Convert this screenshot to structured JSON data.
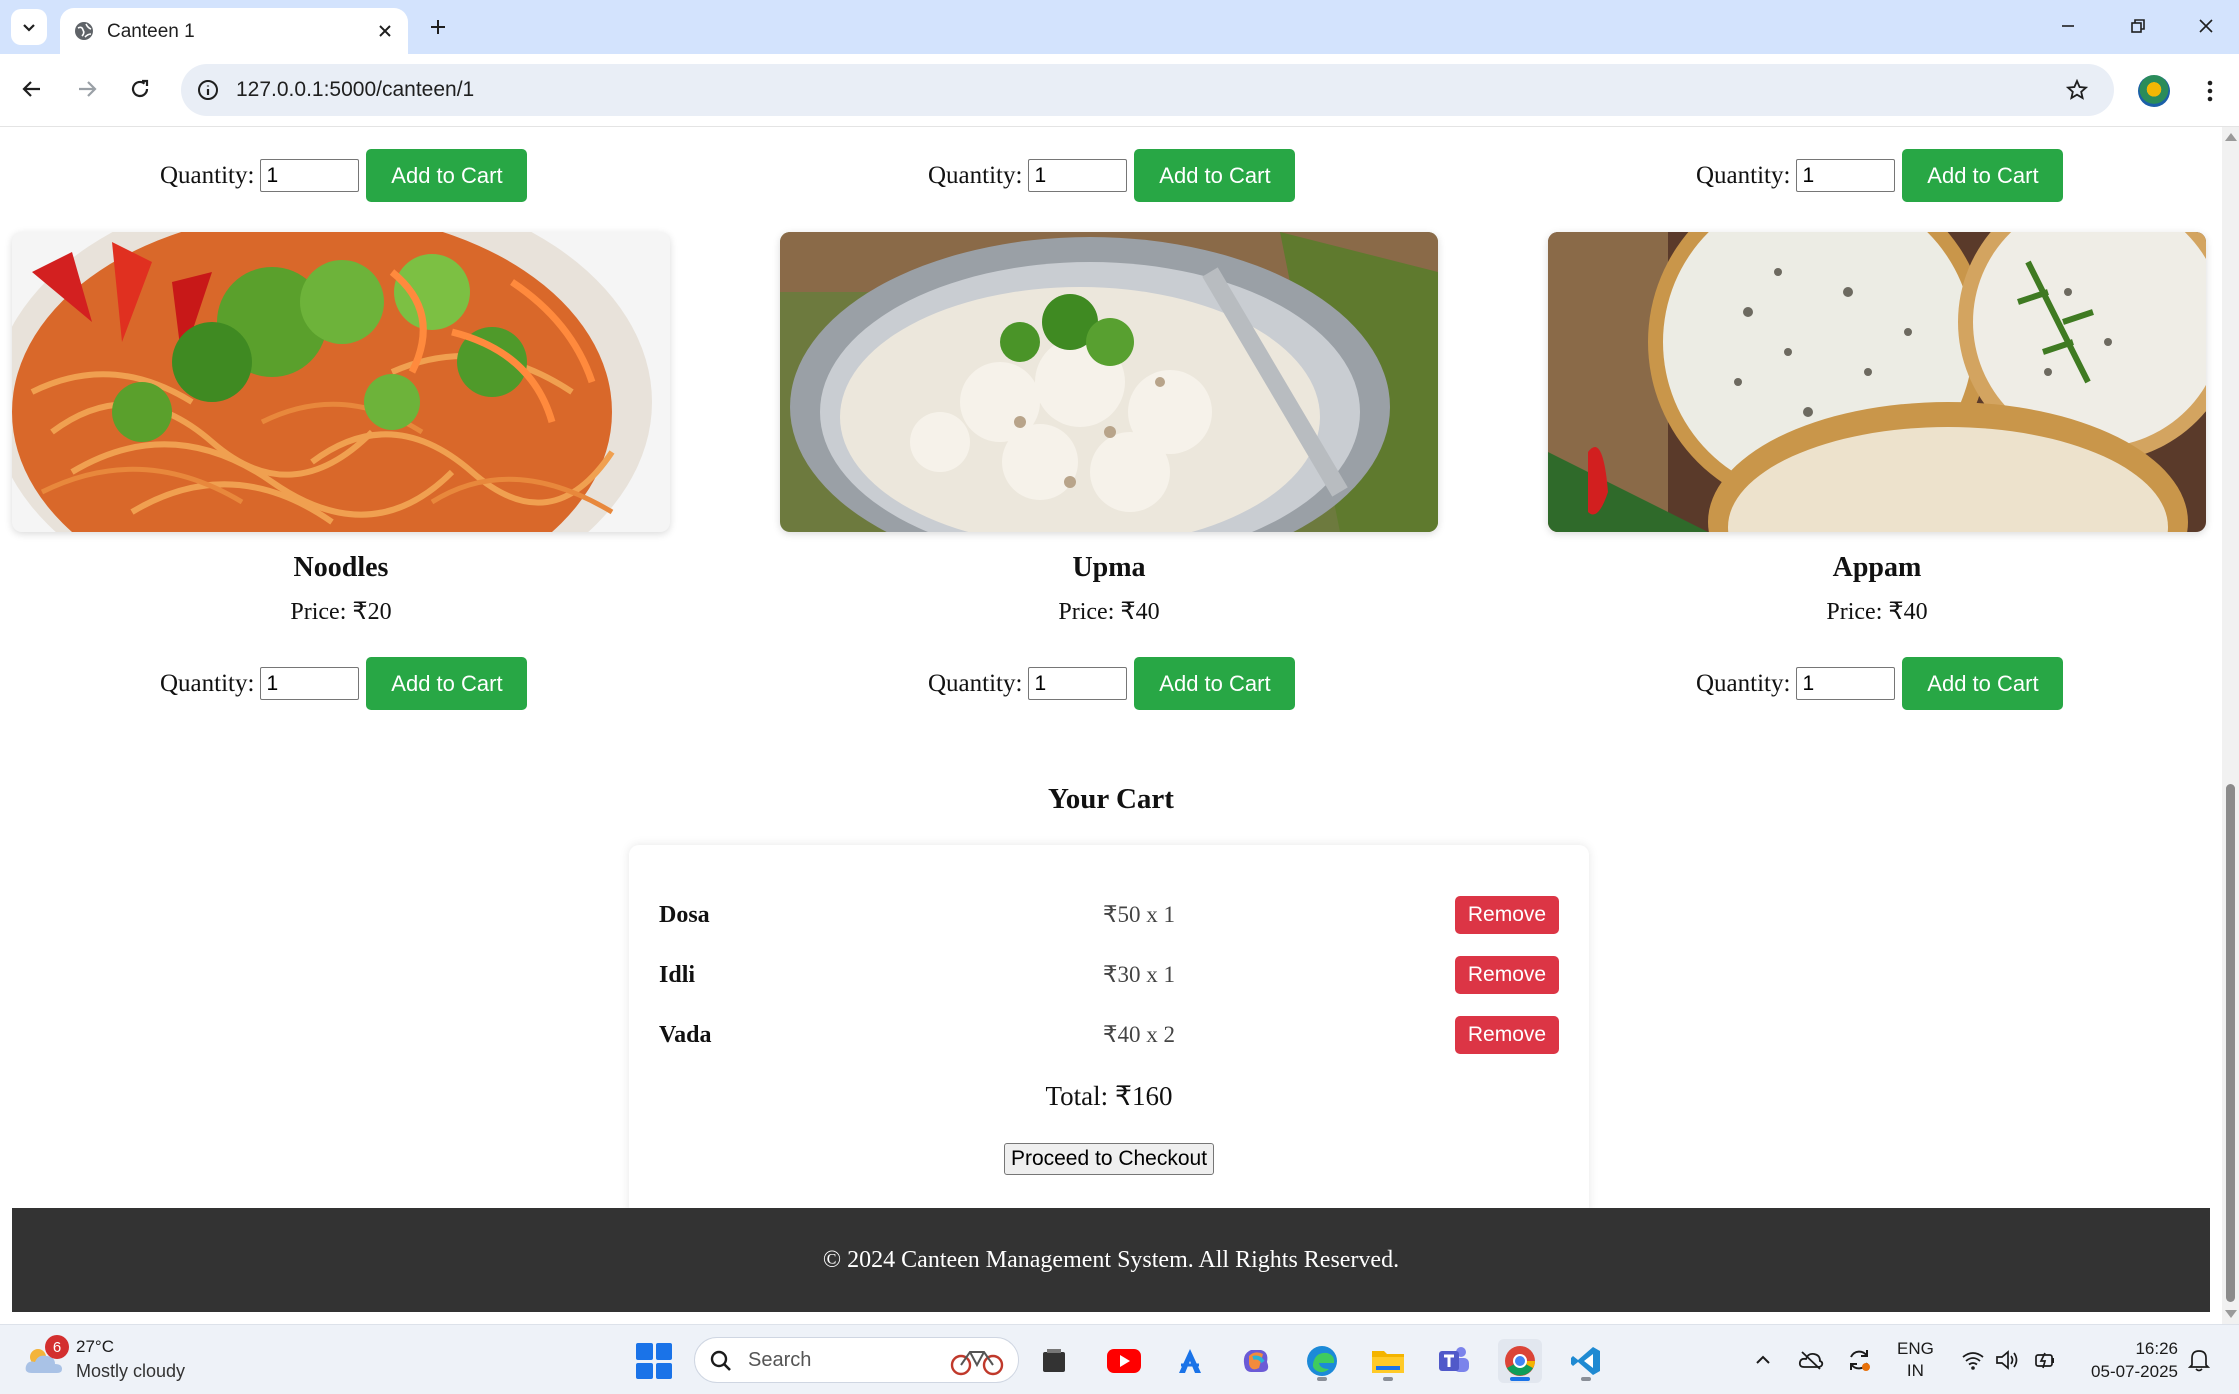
{
  "browser": {
    "tab_title": "Canteen 1",
    "url": "127.0.0.1:5000/canteen/1"
  },
  "page": {
    "quantity_label": "Quantity:",
    "add_to_cart_label": "Add to Cart",
    "top_row_quantities": [
      "1",
      "1",
      "1"
    ],
    "items": [
      {
        "name": "Noodles",
        "price": "Price: ₹20",
        "quantity": "1"
      },
      {
        "name": "Upma",
        "price": "Price: ₹40",
        "quantity": "1"
      },
      {
        "name": "Appam",
        "price": "Price: ₹40",
        "quantity": "1"
      }
    ],
    "cart": {
      "heading": "Your Cart",
      "remove_label": "Remove",
      "items": [
        {
          "name": "Dosa",
          "price_qty": "₹50 x 1"
        },
        {
          "name": "Idli",
          "price_qty": "₹30 x 1"
        },
        {
          "name": "Vada",
          "price_qty": "₹40 x 2"
        }
      ],
      "total": "Total: ₹160",
      "checkout_label": "Proceed to Checkout"
    },
    "footer": "© 2024 Canteen Management System. All Rights Reserved."
  },
  "colors": {
    "add_button": "#28a745",
    "remove_button": "#dc3545",
    "footer_bg": "#333333",
    "tabstrip_bg": "#d3e3fd"
  },
  "taskbar": {
    "weather_badge": "6",
    "weather_temp": "27°C",
    "weather_desc": "Mostly cloudy",
    "search_placeholder": "Search",
    "lang_line1": "ENG",
    "lang_line2": "IN",
    "time": "16:26",
    "date": "05-07-2025",
    "apps": [
      "file-explorer-icon",
      "youtube-icon",
      "app-store-icon",
      "copilot-icon",
      "edge-icon",
      "folder-icon",
      "teams-icon",
      "chrome-icon",
      "vscode-icon"
    ]
  }
}
